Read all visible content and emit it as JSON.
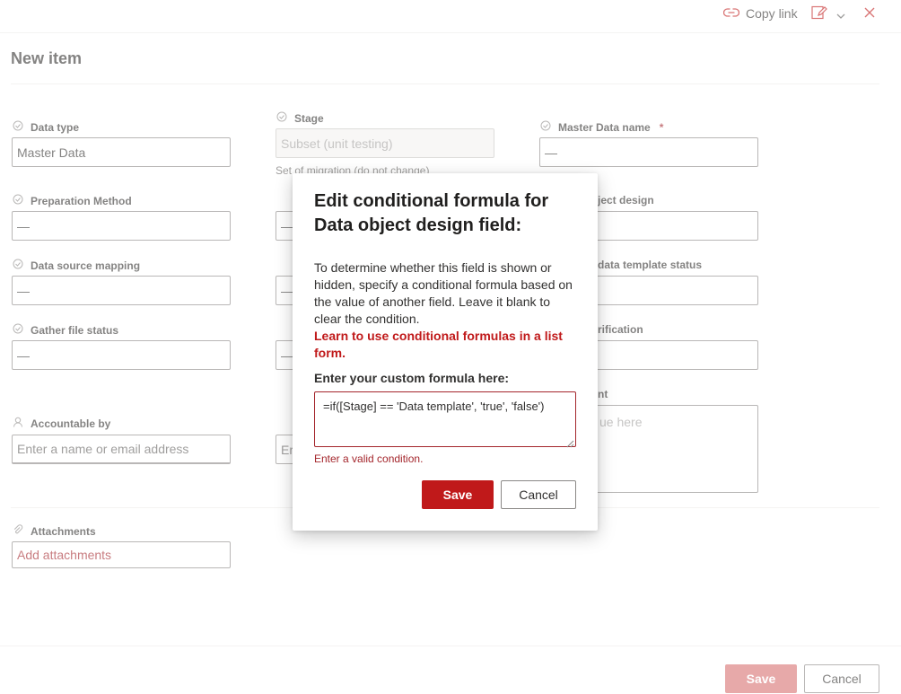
{
  "header": {
    "copy_link": "Copy link",
    "edit_form_icon": "edit-form-icon",
    "close_icon": "close-icon"
  },
  "page_title": "New item",
  "fields": {
    "data_type": {
      "label": "Data type",
      "value": "Master Data"
    },
    "stage": {
      "label": "Stage",
      "value": "Subset (unit testing)",
      "hint": "Set of migration (do not change)"
    },
    "master_data_name": {
      "label": "Master Data name",
      "required_mark": "*",
      "value": "—"
    },
    "preparation_method": {
      "label": "Preparation Method",
      "value": "—"
    },
    "col2_row2": {
      "value": "—"
    },
    "data_object_design": {
      "label": "Data object design",
      "visible_label": "ject design"
    },
    "data_source_mapping": {
      "label": "Data source mapping",
      "value": "—"
    },
    "col2_row3": {
      "value": "—"
    },
    "data_template_status": {
      "visible_label": "data template status"
    },
    "gather_file_status": {
      "label": "Gather file status",
      "value": "—"
    },
    "col2_row4": {
      "value": "—"
    },
    "verification": {
      "visible_label": "rification"
    },
    "comment": {
      "visible_label": "nt",
      "placeholder": "ue here"
    },
    "accountable_by": {
      "label": "Accountable by",
      "placeholder": "Enter a name or email address"
    },
    "col2_person": {
      "placeholder": "Er"
    },
    "attachments": {
      "label": "Attachments",
      "action": "Add attachments"
    }
  },
  "footer": {
    "save": "Save",
    "cancel": "Cancel"
  },
  "dialog": {
    "title": "Edit conditional formula for Data object design field:",
    "body": "To determine whether this field is shown or hidden, specify a conditional formula based on the value of another field. Leave it blank to clear the condition.",
    "link": "Learn to use conditional formulas in a list form.",
    "input_label": "Enter your custom formula here:",
    "formula": "=if([Stage] == 'Data template', 'true', 'false')",
    "error": "Enter a valid condition.",
    "save": "Save",
    "cancel": "Cancel"
  },
  "colors": {
    "accent": "#c0191a",
    "error": "#a4262c",
    "border": "#8a8886"
  }
}
